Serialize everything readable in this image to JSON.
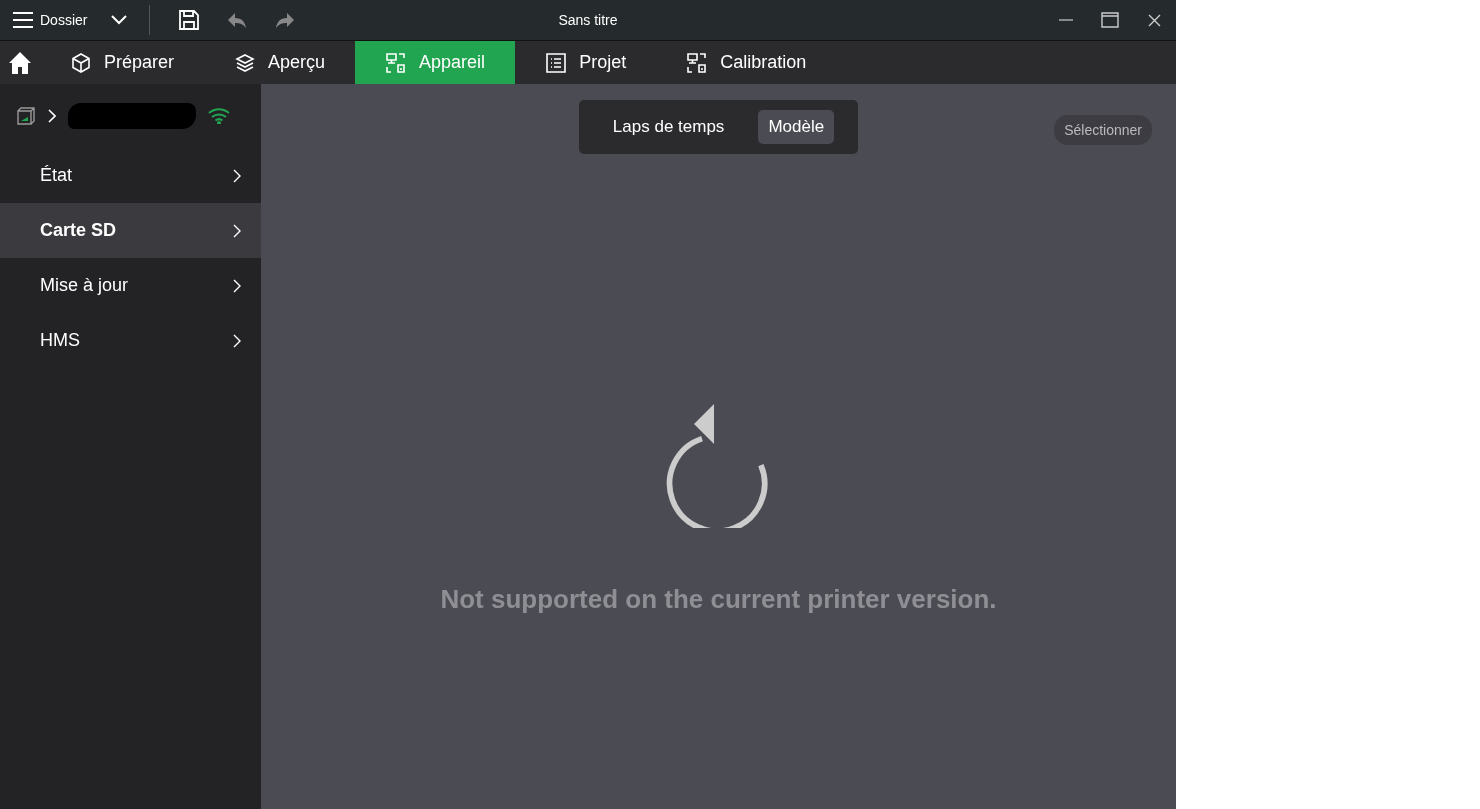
{
  "window": {
    "title": "Sans titre",
    "menu_label": "Dossier"
  },
  "tabs": [
    {
      "label": "Préparer",
      "kind": "cube",
      "selected": false
    },
    {
      "label": "Aperçu",
      "kind": "layers",
      "selected": false
    },
    {
      "label": "Appareil",
      "kind": "device",
      "selected": true
    },
    {
      "label": "Projet",
      "kind": "list",
      "selected": false
    },
    {
      "label": "Calibration",
      "kind": "device",
      "selected": false
    }
  ],
  "sidebar": {
    "items": [
      {
        "label": "État",
        "selected": false
      },
      {
        "label": "Carte SD",
        "selected": true
      },
      {
        "label": "Mise à jour",
        "selected": false
      },
      {
        "label": "HMS",
        "selected": false
      }
    ]
  },
  "segments": [
    {
      "label": "Laps de temps",
      "selected": false
    },
    {
      "label": "Modèle",
      "selected": true
    }
  ],
  "select_button": "Sélectionner",
  "message": "Not supported on the current printer version."
}
